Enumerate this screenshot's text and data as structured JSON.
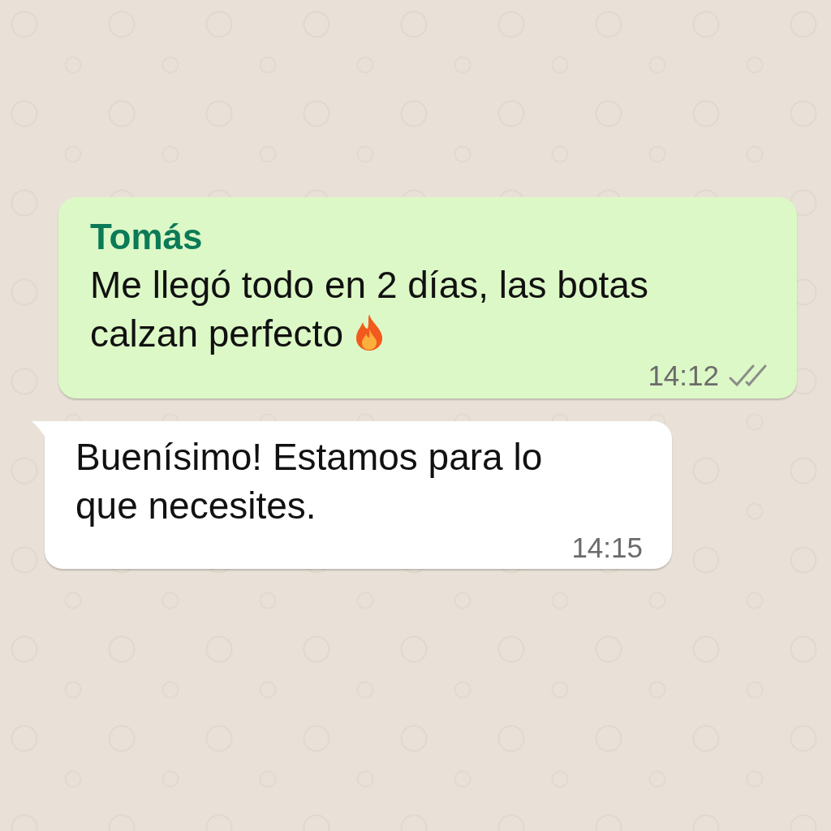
{
  "messages": [
    {
      "kind": "outgoing",
      "tail": false,
      "sender": "Tomás",
      "text": "Me llegó todo en 2 días, las botas calzan perfecto",
      "emoji": true,
      "time": "14:12",
      "read": false
    },
    {
      "kind": "incoming",
      "tail": true,
      "text": "Buenísimo! Estamos para lo que necesites.",
      "emoji": false,
      "time": "14:15"
    }
  ]
}
